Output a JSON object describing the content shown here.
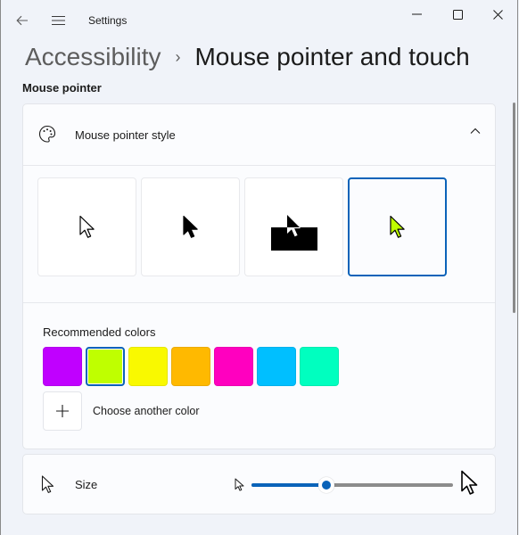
{
  "window": {
    "title": "Settings",
    "controls": {
      "minimize": "minimize",
      "maximize": "maximize",
      "close": "close"
    }
  },
  "breadcrumb": {
    "parent": "Accessibility",
    "separator": "›",
    "current": "Mouse pointer and touch"
  },
  "section": {
    "label": "Mouse pointer"
  },
  "pointer_style": {
    "label": "Mouse pointer style",
    "expanded": true,
    "options": [
      {
        "name": "white",
        "selected": false
      },
      {
        "name": "black",
        "selected": false
      },
      {
        "name": "inverted",
        "selected": false
      },
      {
        "name": "custom",
        "selected": true
      }
    ],
    "recommended_label": "Recommended colors",
    "colors": [
      {
        "hex": "#c000ff",
        "selected": false
      },
      {
        "hex": "#bfff00",
        "selected": true
      },
      {
        "hex": "#f9f900",
        "selected": false
      },
      {
        "hex": "#ffb900",
        "selected": false
      },
      {
        "hex": "#ff00bf",
        "selected": false
      },
      {
        "hex": "#00bfff",
        "selected": false
      },
      {
        "hex": "#00ffbf",
        "selected": false
      }
    ],
    "choose_another_label": "Choose another color",
    "accent": "#0a63b9"
  },
  "size": {
    "label": "Size",
    "value_fraction": 0.37
  }
}
